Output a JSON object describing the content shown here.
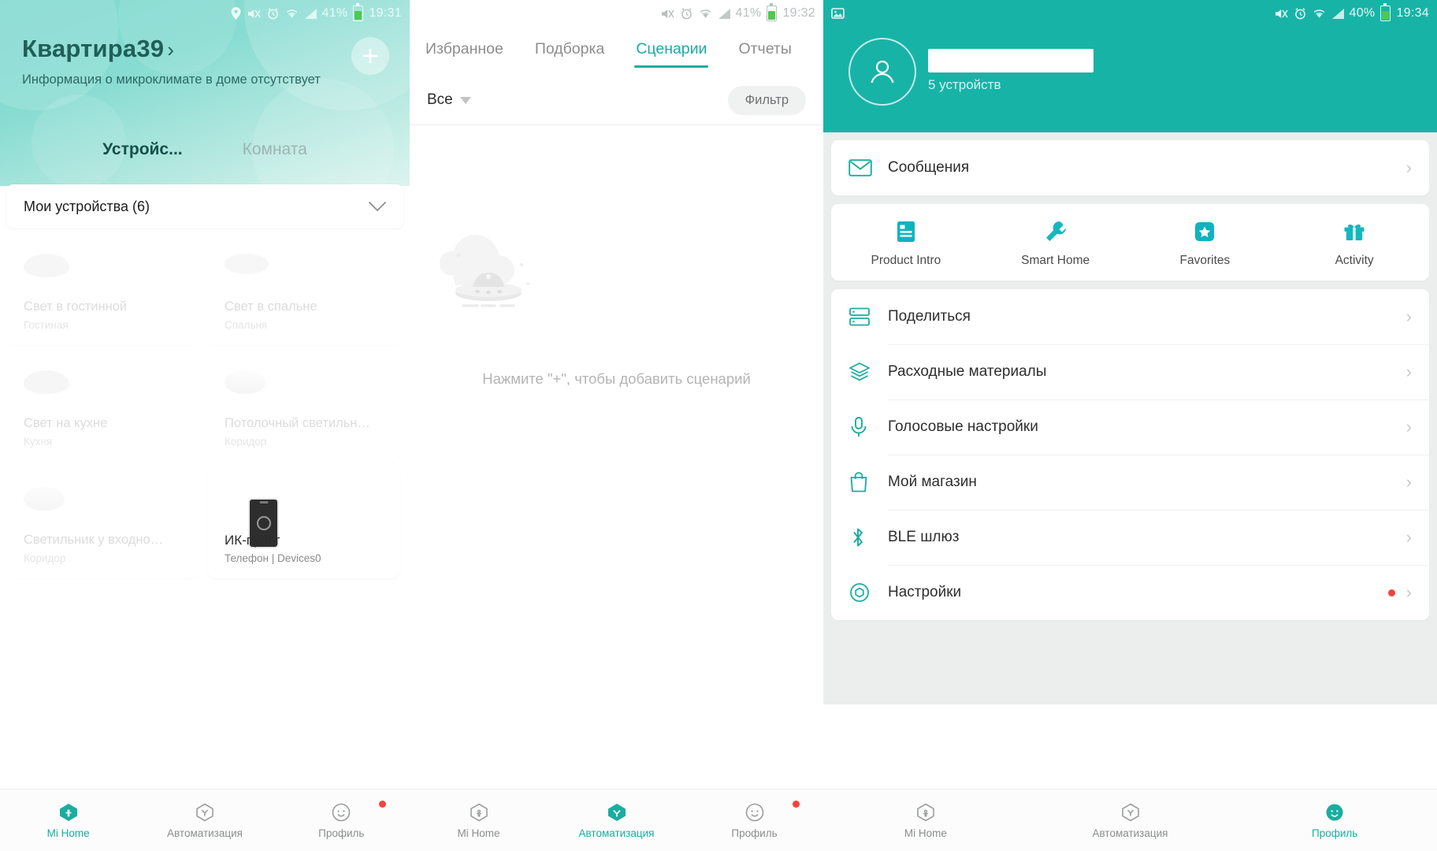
{
  "panel1": {
    "status": {
      "time": "19:31",
      "battery_pct": "41%",
      "icons": [
        "location-icon",
        "mute-icon",
        "alarm-icon",
        "wifi-icon",
        "signal-icon"
      ]
    },
    "home_name": "Квартира39",
    "chevron": "›",
    "subtitle": "Информация о микроклимате в доме отсутствует",
    "add_button": "add-icon",
    "tabs": [
      {
        "label": "Устройс...",
        "active": true
      },
      {
        "label": "Комната",
        "active": false
      }
    ],
    "group_header": "Мои устройства (6)",
    "devices": [
      {
        "name": "Свет в гостинной",
        "room": "Гостиная",
        "icon": "lamp",
        "bright": false
      },
      {
        "name": "Свет в спальне",
        "room": "Спальня",
        "icon": "lamp2",
        "bright": false
      },
      {
        "name": "Свет на кухне",
        "room": "Кухня",
        "icon": "lamp",
        "bright": false
      },
      {
        "name": "Потолочный светильн…",
        "room": "Коридор",
        "icon": "puck",
        "bright": false
      },
      {
        "name": "Светильник у входно…",
        "room": "Коридор",
        "icon": "puck",
        "bright": false
      },
      {
        "name": "ИК-пульт",
        "room": "Телефон | Devices0",
        "icon": "phone",
        "bright": true
      }
    ],
    "bottom_nav": [
      {
        "label": "Mi Home",
        "icon": "home-icon",
        "active": true,
        "dot": false
      },
      {
        "label": "Автоматизация",
        "icon": "automation-icon",
        "active": false,
        "dot": false
      },
      {
        "label": "Профиль",
        "icon": "profile-icon",
        "active": false,
        "dot": true
      }
    ]
  },
  "panel2": {
    "status": {
      "time": "19:32",
      "battery_pct": "41%",
      "icons": [
        "mute-icon",
        "alarm-icon",
        "wifi-icon",
        "signal-icon"
      ]
    },
    "tabs": [
      {
        "label": "Избранное",
        "active": false
      },
      {
        "label": "Подборка",
        "active": false
      },
      {
        "label": "Сценарии",
        "active": true
      },
      {
        "label": "Отчеты",
        "active": false
      }
    ],
    "add_button": "plus-icon",
    "filter_select": "Все",
    "filter_button": "Фильтр",
    "empty_text": "Нажмите \"+\", чтобы добавить сценарий",
    "empty_illustration": "ufo-cloud-illustration",
    "bottom_nav": [
      {
        "label": "Mi Home",
        "icon": "home-icon",
        "active": false,
        "dot": false
      },
      {
        "label": "Автоматизация",
        "icon": "automation-icon",
        "active": true,
        "dot": false
      },
      {
        "label": "Профиль",
        "icon": "profile-icon",
        "active": false,
        "dot": true
      }
    ]
  },
  "panel3": {
    "status": {
      "time": "19:34",
      "battery_pct": "40%",
      "icons": [
        "mute-icon",
        "alarm-icon",
        "wifi-icon",
        "signal-icon"
      ],
      "gallery_icon": "image-icon"
    },
    "account": {
      "name_masked": "",
      "devices": "5 устройств",
      "avatar": "person-icon"
    },
    "messages_row": {
      "label": "Сообщения",
      "icon": "mail-icon"
    },
    "quick_actions": [
      {
        "label": "Product Intro",
        "icon": "document-icon"
      },
      {
        "label": "Smart Home",
        "icon": "wrench-icon"
      },
      {
        "label": "Favorites",
        "icon": "star-badge-icon"
      },
      {
        "label": "Activity",
        "icon": "gift-icon"
      }
    ],
    "menu": [
      {
        "label": "Поделиться",
        "icon": "share-icon",
        "dot": false
      },
      {
        "label": "Расходные материалы",
        "icon": "layers-icon",
        "dot": false
      },
      {
        "label": "Голосовые настройки",
        "icon": "mic-icon",
        "dot": false
      },
      {
        "label": "Мой магазин",
        "icon": "bag-icon",
        "dot": false
      },
      {
        "label": "BLE шлюз",
        "icon": "bluetooth-icon",
        "dot": false
      },
      {
        "label": "Настройки",
        "icon": "gear-icon",
        "dot": true
      }
    ],
    "bottom_nav": [
      {
        "label": "Mi Home",
        "icon": "home-icon",
        "active": false,
        "dot": false
      },
      {
        "label": "Автоматизация",
        "icon": "automation-icon",
        "active": false,
        "dot": false
      },
      {
        "label": "Профиль",
        "icon": "profile-icon",
        "active": true,
        "dot": false
      }
    ]
  },
  "colors": {
    "accent": "#1aada0",
    "header_teal": "#18b3a7",
    "danger": "#f4433c"
  }
}
